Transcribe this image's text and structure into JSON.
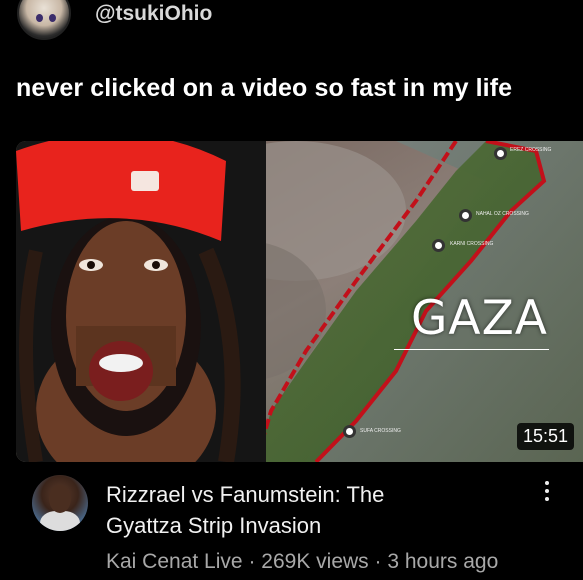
{
  "post": {
    "username": "@tsukiOhio",
    "caption": "never clicked on a video so fast in my life"
  },
  "video": {
    "map_label": "GAZA",
    "duration": "15:51",
    "title_line1": "Rizzrael vs Fanumstein: The",
    "title_line2": "Gyattza Strip Invasion",
    "channel": "Kai Cenat Live",
    "views": "269K views",
    "age": "3 hours ago",
    "separator": "·",
    "markers": [
      "EREZ CROSSING",
      "NAHAL OZ CROSSING",
      "KARNI CROSSING",
      "SUFA CROSSING"
    ]
  },
  "colors": {
    "background": "#000000",
    "border_red": "#c2101a",
    "meta_text": "#a8a8a8"
  },
  "icons": [
    "user-avatar-icon",
    "channel-avatar-icon",
    "more-options-icon"
  ]
}
